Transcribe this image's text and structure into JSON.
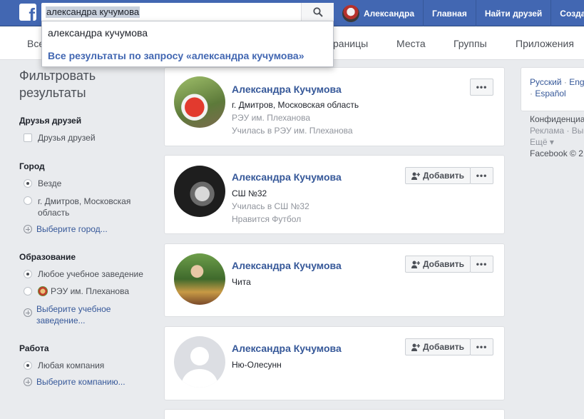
{
  "search": {
    "value": "александра кучумова",
    "button_icon": "search-icon"
  },
  "topnav": {
    "user": "Александра",
    "home": "Главная",
    "find_friends": "Найти друзей",
    "create": "Созда"
  },
  "dropdown": {
    "suggestion": "александра кучумова",
    "all_results": "Все результаты по запросу «александра кучумова»"
  },
  "tabs": {
    "all": "Все",
    "pages": "раницы",
    "places": "Места",
    "groups": "Группы",
    "apps": "Приложения"
  },
  "filters": {
    "title_line1": "Фильтровать",
    "title_line2": "результаты",
    "friends_of_friends": {
      "heading": "Друзья друзей",
      "option": "Друзья друзей"
    },
    "city": {
      "heading": "Город",
      "anywhere": "Везде",
      "dmitrov_line1": "г. Дмитров, Московская",
      "dmitrov_line2": "область",
      "choose": "Выберите город..."
    },
    "education": {
      "heading": "Образование",
      "any": "Любое учебное заведение",
      "reu": "РЭУ им. Плеханова",
      "choose_line1": "Выберите учебное",
      "choose_line2": "заведение..."
    },
    "work": {
      "heading": "Работа",
      "any": "Любая компания",
      "choose": "Выберите компанию..."
    }
  },
  "results": [
    {
      "name": "Александра Кучумова",
      "lines": [
        "г. Дмитров, Московская область",
        "РЭУ им. Плеханова",
        "Училась в РЭУ им. Плеханова"
      ],
      "add": ""
    },
    {
      "name": "Александра Кучумова",
      "lines": [
        "СШ №32",
        "Училась в СШ №32",
        "Нравится Футбол"
      ],
      "add": "Добавить"
    },
    {
      "name": "Александра Кучумова",
      "lines": [
        "Чита"
      ],
      "add": "Добавить"
    },
    {
      "name": "Александра Кучумова",
      "lines": [
        "Ню-Олесунн"
      ],
      "add": "Добавить"
    }
  ],
  "more_button": "•••",
  "right": {
    "lang_ru": "Русский",
    "lang_sep": "·",
    "lang_en": "Eng",
    "lang_es": "Español",
    "footer_line1": "Конфиденциа",
    "footer_line2": "Реклама · Вы",
    "footer_line3": "Ещё ▾",
    "footer_line4": "Facebook © 2"
  }
}
